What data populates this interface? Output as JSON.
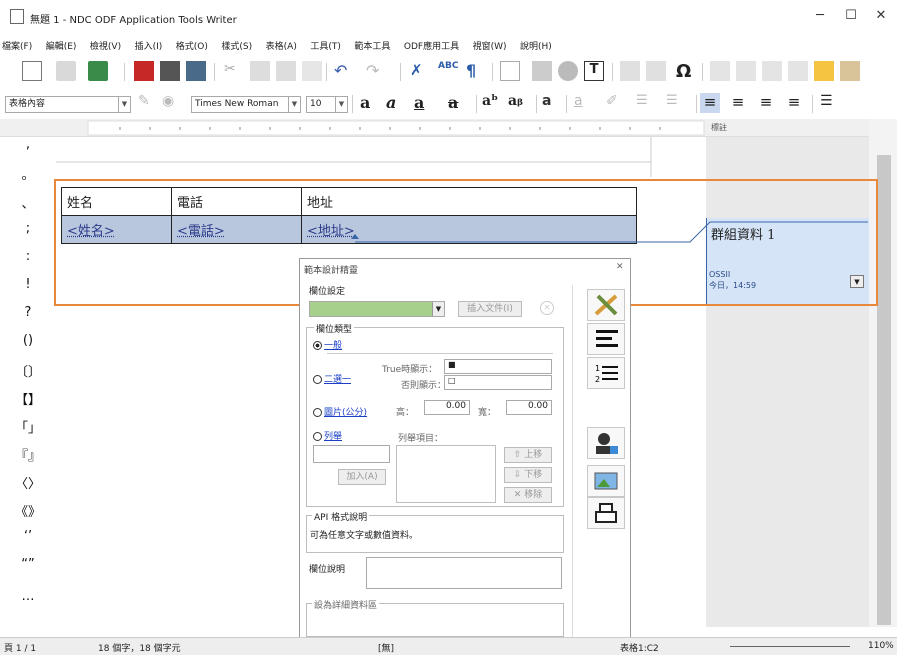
{
  "window": {
    "title": "無題 1 - NDC ODF Application Tools Writer",
    "min": "─",
    "max": "☐",
    "close": "✕"
  },
  "menu": [
    "檔案(F)",
    "編輯(E)",
    "檢視(V)",
    "插入(I)",
    "格式(O)",
    "樣式(S)",
    "表格(A)",
    "工具(T)",
    "範本工具",
    "ODF應用工具",
    "視窗(W)",
    "說明(H)"
  ],
  "format": {
    "style": "表格內容",
    "font": "Times New Roman",
    "size": "10"
  },
  "ruler_label": "標註",
  "left_symbols": [
    ",",
    "。",
    "、",
    ";",
    ":",
    "!",
    "?",
    "()",
    "〔〕",
    "【】",
    "「」",
    "『』",
    "〈〉",
    "《》",
    "‘’",
    "“”",
    "…"
  ],
  "table": {
    "headers": [
      "姓名",
      "電話",
      "地址"
    ],
    "fields": [
      "<姓名>",
      "<電話>",
      "<地址>"
    ]
  },
  "comment": {
    "text": "群組資料 1",
    "author": "OSSII",
    "time": "今日，14:59"
  },
  "dialog": {
    "title": "範本設計精靈",
    "close": "✕",
    "field_settings": "欄位設定",
    "insert_file": "插入文件(I)",
    "field_type": "欄位類型",
    "general": "一般",
    "binary": "二選一",
    "true_show": "True時顯示：",
    "else_show": "否則顯示：",
    "true_value": "■",
    "else_value": "□",
    "image": "圖片(公分)",
    "height_label": "高：",
    "width_label": "寬：",
    "height_value": "0.00",
    "width_value": "0.00",
    "enum": "列舉",
    "enum_items": "列舉項目：",
    "add": "加入(A)",
    "up": "上移",
    "down": "下移",
    "remove": "移除",
    "api_title": "API 格式說明",
    "api_text": "可為任意文字或數值資料。",
    "field_desc": "欄位說明",
    "detail_area": "設為詳細資料區"
  },
  "status": {
    "page": "頁 1 / 1",
    "words": "18 個字，18 個字元",
    "lang": "[無]",
    "cell": "表格1:C2",
    "zoom": "110%"
  },
  "colors": {
    "selection": "#b8c7de",
    "orange": "#e8883a",
    "comment_bg": "#d6e4f7"
  }
}
